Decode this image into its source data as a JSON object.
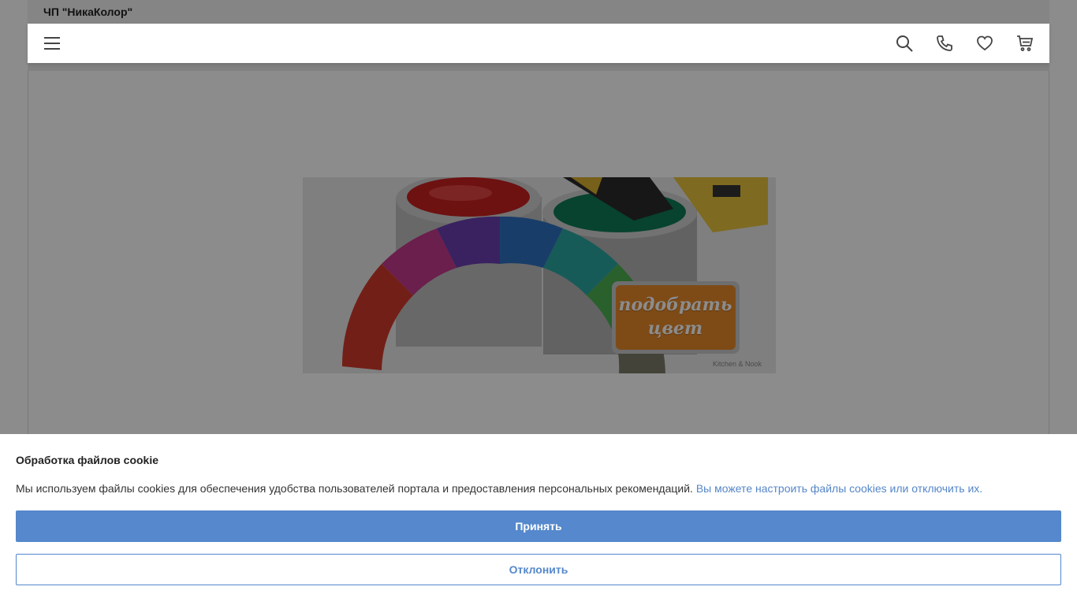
{
  "site": {
    "company_name": "ЧП \"НикаКолор\"",
    "header_icons": [
      "menu-icon",
      "search-icon",
      "phone-icon",
      "heart-icon",
      "cart-icon"
    ]
  },
  "banner": {
    "label_line1": "подобрать",
    "label_line2": "цвет",
    "accent_color": "#e5892a"
  },
  "cookie": {
    "title": "Обработка файлов cookie",
    "text": "Мы используем файлы cookies для обеспечения удобства пользователей портала и предоставления персональных рекомендаций.",
    "link_text": "Вы можете настроить файлы cookies или отключить их.",
    "accept_label": "Принять",
    "decline_label": "Отклонить",
    "accent_color": "#5588cc"
  }
}
